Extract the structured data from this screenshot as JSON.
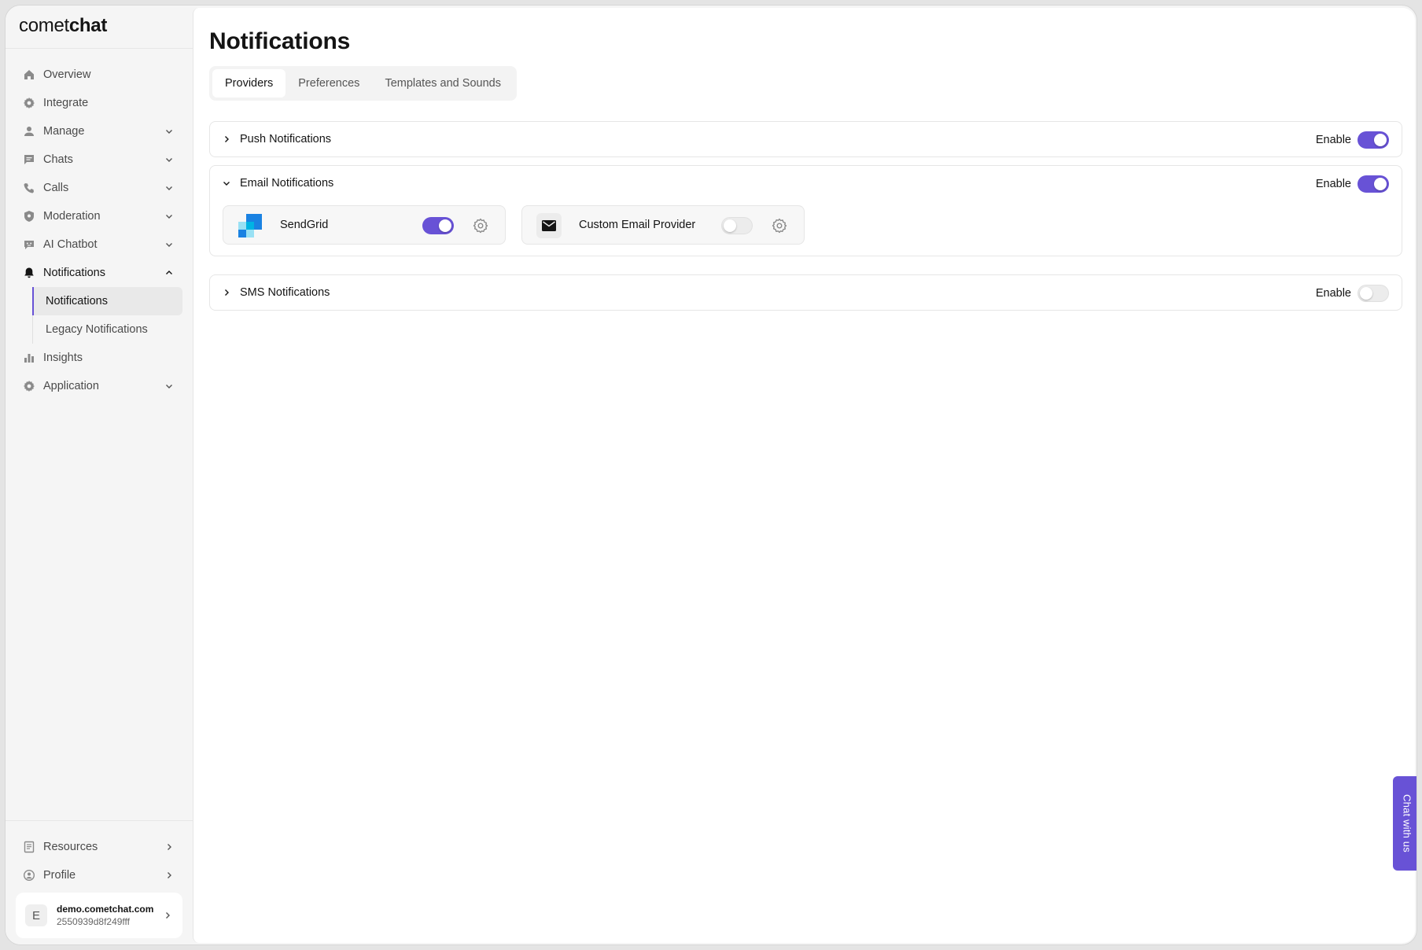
{
  "brand": {
    "prefix": "comet",
    "suffix": "chat"
  },
  "sidebar": {
    "items": [
      {
        "label": "Overview",
        "icon": "home-icon"
      },
      {
        "label": "Integrate",
        "icon": "gear-icon"
      },
      {
        "label": "Manage",
        "icon": "user-icon"
      },
      {
        "label": "Chats",
        "icon": "chat-icon"
      },
      {
        "label": "Calls",
        "icon": "phone-icon"
      },
      {
        "label": "Moderation",
        "icon": "shield-icon"
      },
      {
        "label": "AI Chatbot",
        "icon": "bot-icon"
      },
      {
        "label": "Notifications",
        "icon": "bell-icon"
      },
      {
        "label": "Insights",
        "icon": "bar-chart-icon"
      },
      {
        "label": "Application",
        "icon": "gear-icon"
      }
    ],
    "notifications_sub": [
      {
        "label": "Notifications"
      },
      {
        "label": "Legacy Notifications"
      }
    ],
    "bottom": [
      {
        "label": "Resources",
        "icon": "book-icon"
      },
      {
        "label": "Profile",
        "icon": "profile-icon"
      }
    ],
    "account": {
      "initial": "E",
      "domain": "demo.cometchat.com",
      "id": "2550939d8f249fff"
    }
  },
  "main": {
    "title": "Notifications",
    "tabs": [
      {
        "label": "Providers"
      },
      {
        "label": "Preferences"
      },
      {
        "label": "Templates and Sounds"
      }
    ],
    "panels": {
      "push": {
        "title": "Push Notifications",
        "enable_label": "Enable",
        "enabled": true
      },
      "email": {
        "title": "Email Notifications",
        "enable_label": "Enable",
        "enabled": true,
        "providers": [
          {
            "name": "SendGrid",
            "enabled": true
          },
          {
            "name": "Custom Email Provider",
            "enabled": false
          }
        ]
      },
      "sms": {
        "title": "SMS Notifications",
        "enable_label": "Enable",
        "enabled": false
      }
    }
  },
  "chat_widget": {
    "label": "Chat with us"
  },
  "colors": {
    "accent": "#6852d6",
    "sendgrid_blue": "#1a82e2",
    "sendgrid_light": "#99e1f4"
  }
}
